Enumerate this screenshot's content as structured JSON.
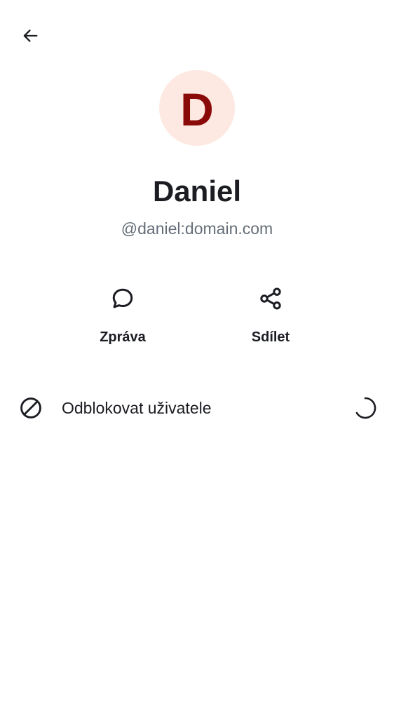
{
  "header": {
    "back_icon": "arrow-left-icon"
  },
  "profile": {
    "avatar_letter": "D",
    "avatar_bg": "#fde9e1",
    "avatar_fg": "#8a0a0a",
    "display_name": "Daniel",
    "user_id": "@daniel:domain.com"
  },
  "actions": {
    "message": {
      "label": "Zpráva",
      "icon": "chat-bubble-icon"
    },
    "share": {
      "label": "Sdílet",
      "icon": "share-icon"
    }
  },
  "settings": {
    "unblock": {
      "label": "Odblokovat uživatele",
      "icon": "block-icon",
      "status_icon": "loading-spinner-icon"
    }
  }
}
